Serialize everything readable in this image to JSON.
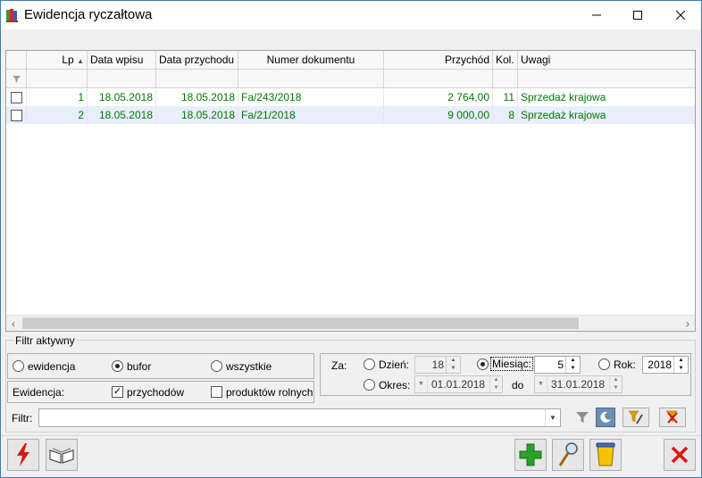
{
  "window": {
    "title": "Ewidencja ryczałtowa"
  },
  "columns": [
    {
      "label": "Lp"
    },
    {
      "label": "Data wpisu"
    },
    {
      "label": "Data przychodu"
    },
    {
      "label": "Numer dokumentu"
    },
    {
      "label": "Przychód"
    },
    {
      "label": "Kol."
    },
    {
      "label": "Uwagi"
    }
  ],
  "rows": [
    {
      "lp": "1",
      "data_wpisu": "18.05.2018",
      "data_przychodu": "18.05.2018",
      "numer": "Fa/243/2018",
      "przychod": "2 764,00",
      "kol": "11",
      "uwagi": "Sprzedaż krajowa"
    },
    {
      "lp": "2",
      "data_wpisu": "18.05.2018",
      "data_przychodu": "18.05.2018",
      "numer": "Fa/21/2018",
      "przychod": "9 000,00",
      "kol": "8",
      "uwagi": "Sprzedaż krajowa"
    }
  ],
  "filter_panel": {
    "legend": "Filtr aktywny",
    "radio_ewidencja": "ewidencja",
    "radio_bufor": "bufor",
    "radio_wszystkie": "wszystkie",
    "ewidencja_label": "Ewidencja:",
    "przychodow": "przychodów",
    "produktow": "produktów rolnych",
    "za_label": "Za:",
    "dzien_label": "Dzień:",
    "dzien_value": "18",
    "miesiac_label": "Miesiąc:",
    "miesiac_value": "5",
    "rok_label": "Rok:",
    "rok_value": "2018",
    "okres_label": "Okres:",
    "okres_od": "01.01.2018",
    "do_label": "do",
    "okres_do": "31.01.2018",
    "filtr_label": "Filtr:",
    "filtr_value": ""
  }
}
